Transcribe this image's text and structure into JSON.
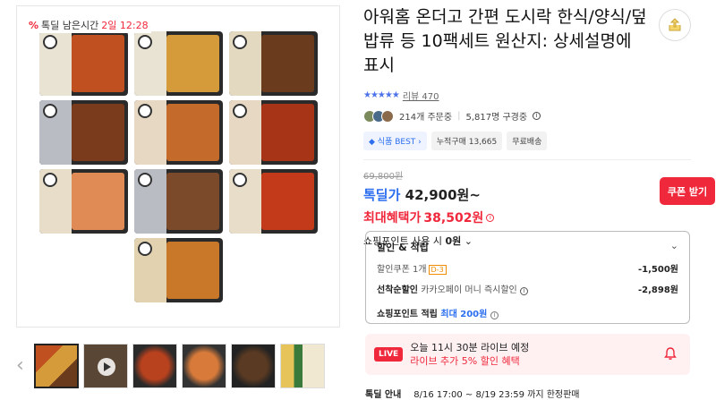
{
  "deal_badge": {
    "label": "톡딜 남은시간",
    "timer": "2일 12:28"
  },
  "product": {
    "title": "아워홈 온더고 간편 도시락 한식/양식/덮밥류 등 10팩세트 원산지: 상세설명에 표시",
    "rating_stars": "★★★★★",
    "review_label": "리뷰 470",
    "orders": "214개 주문중",
    "subscribers": "5,817명 구경중",
    "tags": [
      "식품 BEST",
      "누적구매 13,665",
      "무료배송"
    ]
  },
  "price": {
    "original": "69,800원",
    "deal_label": "톡딜가",
    "deal_price": "42,900원~",
    "max_benefit_label": "최대혜택가",
    "max_benefit_price": "38,502원",
    "coupon_button": "쿠폰 받기",
    "point_use_label": "쇼핑포인트 사용 시",
    "point_use_value": "0원"
  },
  "discount_box": {
    "title": "할인 & 적립",
    "coupon_label": "할인쿠폰 1개",
    "coupon_badge": "D-3",
    "coupon_value": "-1,500원",
    "firstcome_label": "선착순할인",
    "firstcome_sub": "카카오페이 머니 즉시할인",
    "firstcome_value": "-2,898원",
    "point_label": "쇼핑포인트 적립",
    "point_max": "최대 200원"
  },
  "live": {
    "badge": "LIVE",
    "title": "오늘 11시 30분 라이브 예정",
    "subtitle": "라이브 추가 5% 할인 혜택"
  },
  "deal_info": {
    "label": "톡딜 안내",
    "period": "8/16 17:00 ~ 8/19 23:59 까지 한정판매"
  },
  "colors": {
    "accent_red": "#f0283c",
    "accent_blue": "#2b6ef0"
  }
}
